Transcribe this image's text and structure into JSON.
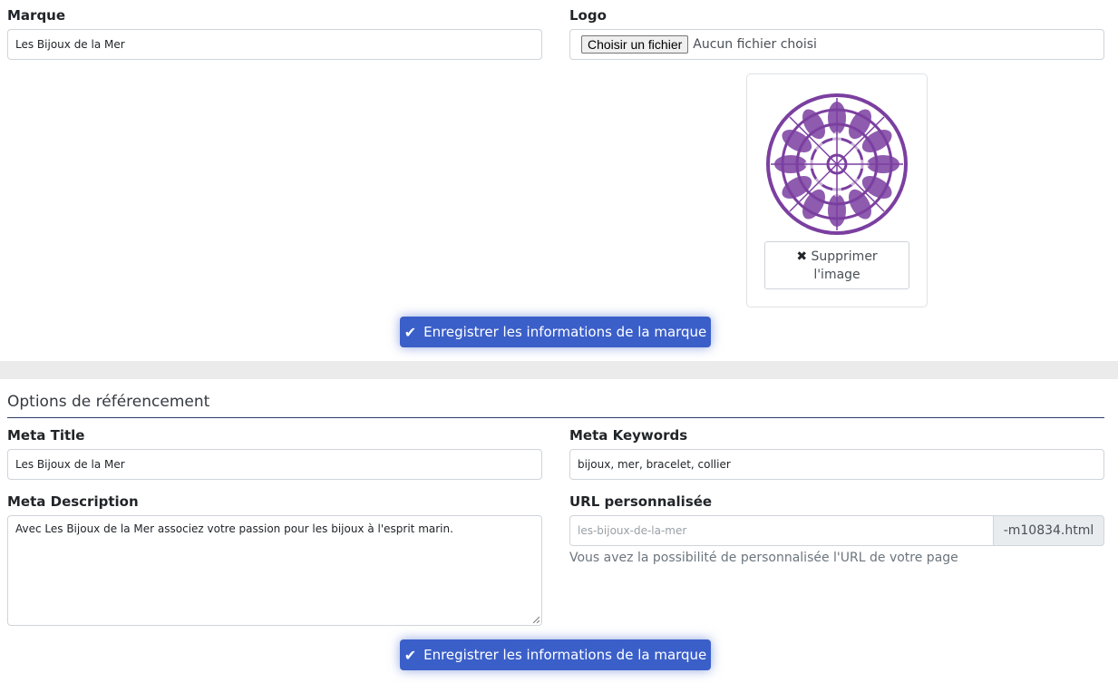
{
  "brand": {
    "marque_label": "Marque",
    "marque_value": "Les Bijoux de la Mer",
    "logo_label": "Logo",
    "file_button": "Choisir un fichier",
    "file_status": "Aucun fichier choisi",
    "delete_image_line1": "Supprimer",
    "delete_image_line2": "l'image",
    "logo_color": "#7b3fa0",
    "save_button": "Enregistrer les informations de la marque"
  },
  "seo": {
    "section_title": "Options de référencement",
    "meta_title_label": "Meta Title",
    "meta_title_value": "Les Bijoux de la Mer",
    "meta_keywords_label": "Meta Keywords",
    "meta_keywords_value": "bijoux, mer, bracelet, collier",
    "meta_description_label": "Meta Description",
    "meta_description_value": "Avec Les Bijoux de la Mer associez votre passion pour les bijoux à l'esprit marin.",
    "url_label": "URL personnalisée",
    "url_placeholder": "les-bijoux-de-la-mer",
    "url_suffix": "-m10834.html",
    "url_help": "Vous avez la possibilité de personnalisée l'URL de votre page",
    "save_button": "Enregistrer les informations de la marque"
  },
  "colors": {
    "primary": "#3b5fc9",
    "separator": "#ebebec"
  }
}
